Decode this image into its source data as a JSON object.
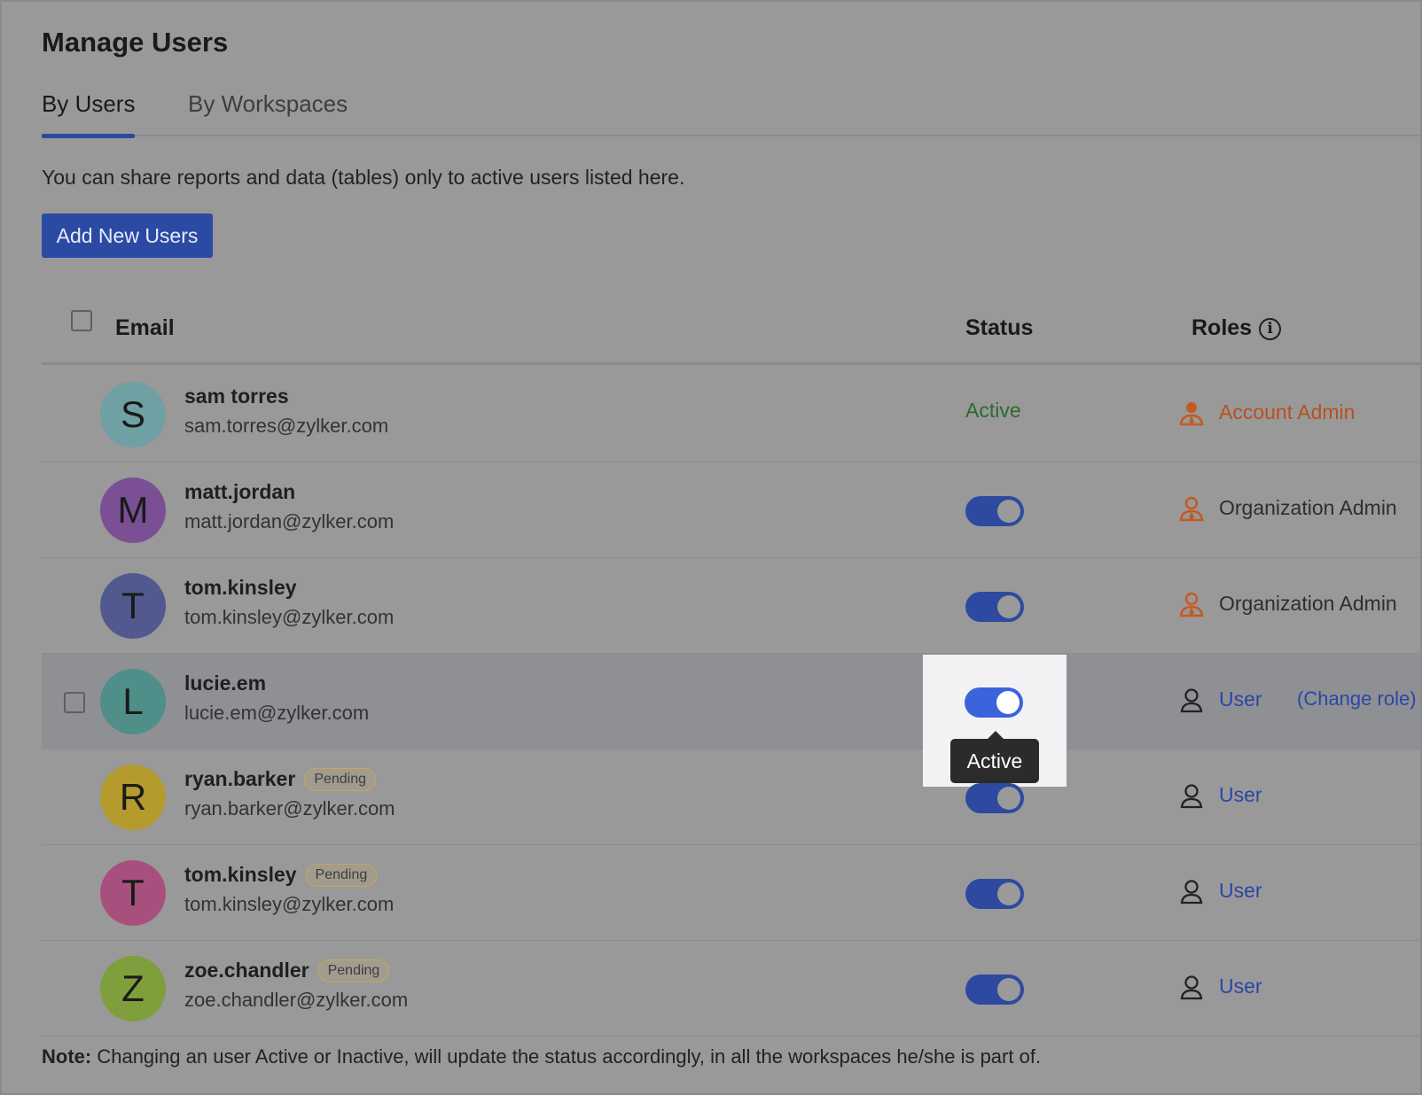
{
  "page": {
    "title": "Manage Users",
    "tabs": [
      {
        "label": "By Users",
        "active": true
      },
      {
        "label": "By Workspaces",
        "active": false
      }
    ],
    "info_text": "You can share reports and data (tables) only to active users listed here.",
    "add_button_label": "Add New Users"
  },
  "table": {
    "headers": {
      "email": "Email",
      "status": "Status",
      "roles": "Roles"
    },
    "rows": [
      {
        "initial": "S",
        "avatar_color": "#6fa0a3",
        "name": "sam torres",
        "email": "sam.torres@zylker.com",
        "badge": "",
        "status": "Active",
        "status_type": "text",
        "role": "Account Admin",
        "role_type": "admin"
      },
      {
        "initial": "M",
        "avatar_color": "#7a4f93",
        "name": "matt.jordan",
        "email": "matt.jordan@zylker.com",
        "badge": "",
        "status": "on",
        "status_type": "toggle",
        "role": "Organization Admin",
        "role_type": "org"
      },
      {
        "initial": "T",
        "avatar_color": "#51598f",
        "name": "tom.kinsley",
        "email": "tom.kinsley@zylker.com",
        "badge": "",
        "status": "on",
        "status_type": "toggle",
        "role": "Organization Admin",
        "role_type": "org"
      },
      {
        "initial": "L",
        "avatar_color": "#4f8e89",
        "name": "lucie.em",
        "email": "lucie.em@zylker.com",
        "badge": "",
        "status": "on",
        "status_type": "toggle",
        "role": "User",
        "role_type": "user",
        "change_role": "(Change role)",
        "tooltip": "Active"
      },
      {
        "initial": "R",
        "avatar_color": "#b59a2d",
        "name": "ryan.barker",
        "email": "ryan.barker@zylker.com",
        "badge": "Pending",
        "status": "on",
        "status_type": "toggle",
        "role": "User",
        "role_type": "user"
      },
      {
        "initial": "T",
        "avatar_color": "#a8507d",
        "name": "tom.kinsley",
        "email": "tom.kinsley@zylker.com",
        "badge": "Pending",
        "status": "on",
        "status_type": "toggle",
        "role": "User",
        "role_type": "user"
      },
      {
        "initial": "Z",
        "avatar_color": "#7f9e3c",
        "name": "zoe.chandler",
        "email": "zoe.chandler@zylker.com",
        "badge": "Pending",
        "status": "on",
        "status_type": "toggle",
        "role": "User",
        "role_type": "user"
      }
    ]
  },
  "note": {
    "label": "Note:",
    "text": " Changing an user Active or Inactive, will update the status accordingly, in all the workspaces he/she is part of."
  },
  "icons": {
    "info": "info-icon",
    "role_admin": "user-solid-icon",
    "role_user": "user-outline-icon"
  },
  "colors": {
    "primary": "#2a4aa3",
    "toggle_on": "#3b64dc",
    "admin_accent": "#b8501f",
    "active_green": "#2c6b2c",
    "link_blue": "#2a47a6"
  }
}
